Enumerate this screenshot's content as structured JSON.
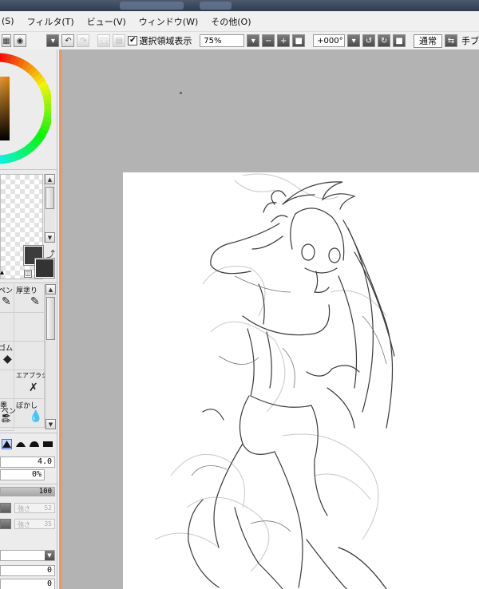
{
  "menu": {
    "items": [
      "(S)",
      "フィルタ(T)",
      "ビュー(V)",
      "ウィンドウ(W)",
      "その他(O)"
    ]
  },
  "toolbar": {
    "selection_checkbox_label": "選択領域表示",
    "selection_checked": true,
    "zoom_value": "75%",
    "rotation_value": "+000°",
    "blend_mode": "通常",
    "tab_cut_label": "手ブ"
  },
  "tools": {
    "items": [
      {
        "label": "ペン",
        "icon": "pen-icon"
      },
      {
        "label": "厚塗り",
        "icon": "thick-paint-icon"
      },
      {
        "label": "",
        "icon": ""
      },
      {
        "label": "",
        "icon": ""
      },
      {
        "label": "ゴム",
        "icon": "eraser-icon"
      },
      {
        "label": "",
        "icon": ""
      },
      {
        "label": "",
        "icon": ""
      },
      {
        "label": "エアブラシ",
        "icon": "airbrush-icon"
      },
      {
        "label": "墨",
        "icon": "ink-brush-icon"
      },
      {
        "label": "ぼかし",
        "icon": "blur-icon"
      },
      {
        "label": "ペン",
        "icon": "pencil-icon"
      },
      {
        "label": "",
        "icon": ""
      }
    ]
  },
  "brush": {
    "size": "4.0",
    "min_size": "0%",
    "density": "100",
    "strength1_label": "強さ",
    "strength1_value": "52",
    "strength2_label": "強さ",
    "strength2_value": "35",
    "value_a": "0",
    "value_b": "0"
  },
  "colors": {
    "foreground": "#3c3c3c",
    "background": "#333333",
    "canvas_bg": "#b3b3b3",
    "panel_edge": "#e59a6b"
  }
}
